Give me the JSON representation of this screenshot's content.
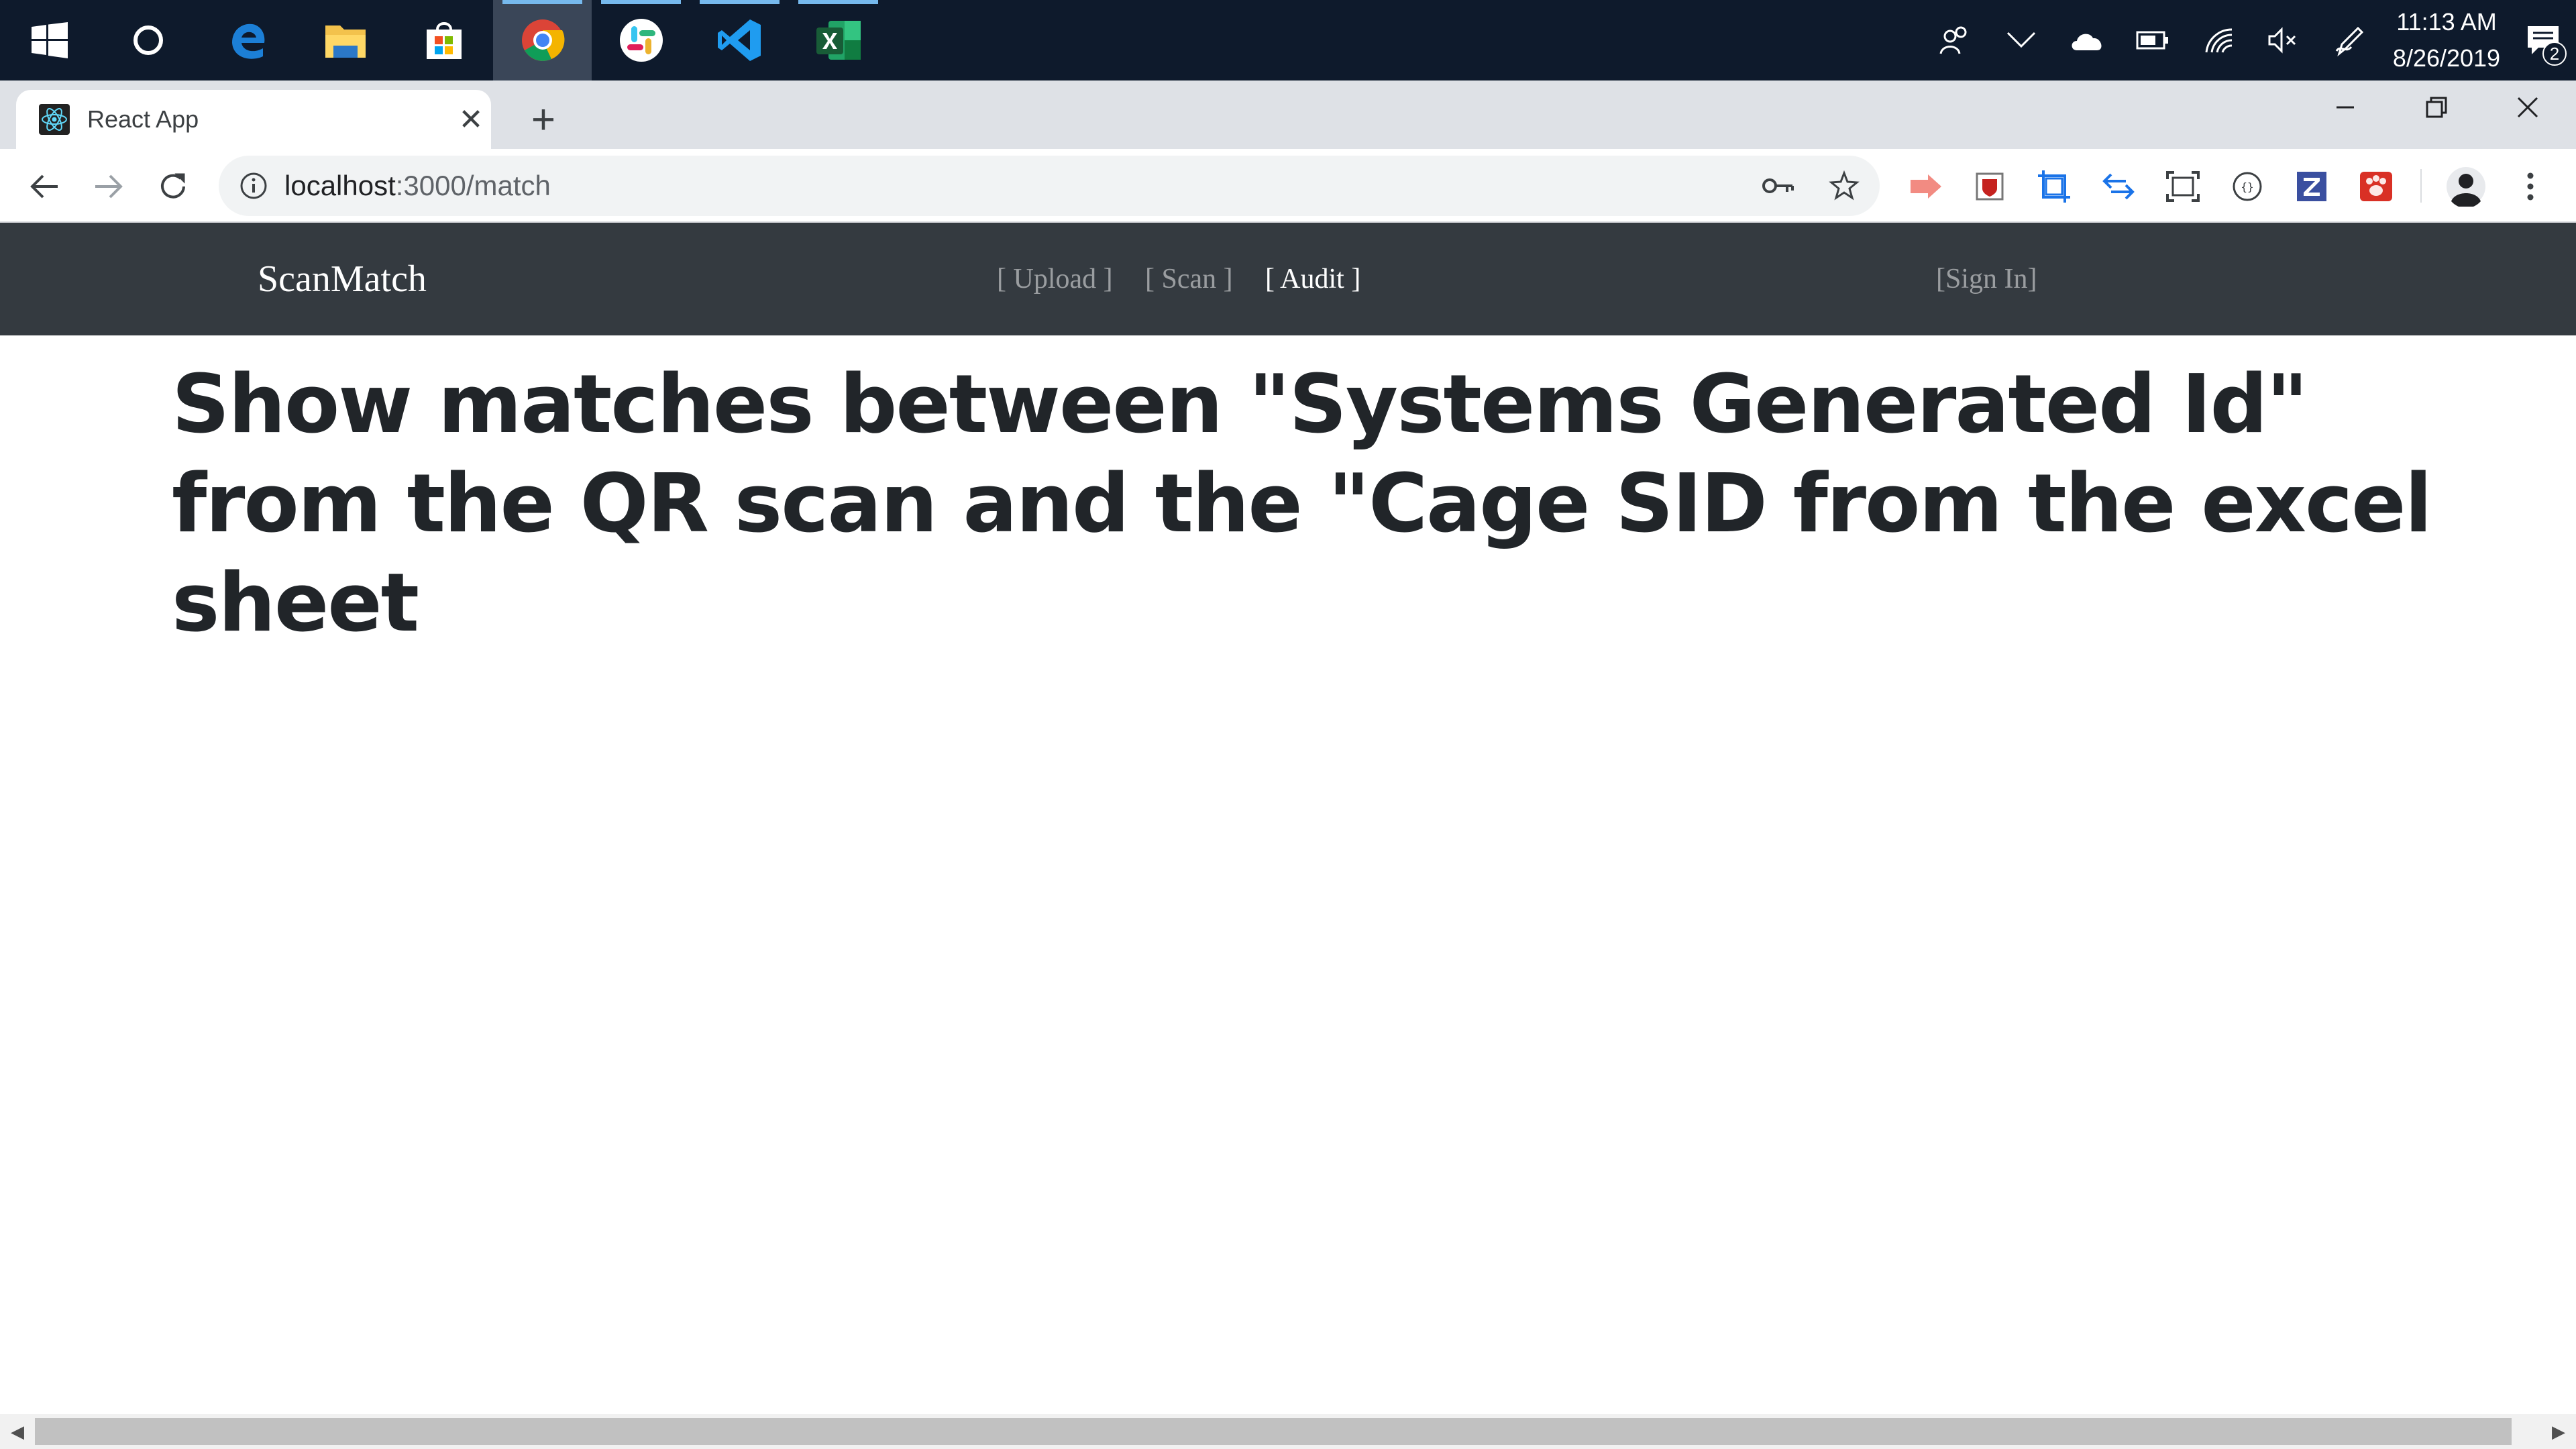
{
  "taskbar": {
    "apps": [
      {
        "name": "windows-start-icon"
      },
      {
        "name": "cortana-icon"
      },
      {
        "name": "edge-icon"
      },
      {
        "name": "file-explorer-icon"
      },
      {
        "name": "store-icon"
      },
      {
        "name": "chrome-icon"
      },
      {
        "name": "slack-icon"
      },
      {
        "name": "vscode-icon"
      },
      {
        "name": "excel-icon"
      }
    ],
    "clock_time": "11:13 AM",
    "clock_date": "8/26/2019",
    "notification_count": "2"
  },
  "browser": {
    "tab_title": "React App",
    "new_tab_label": "+",
    "url_host": "localhost",
    "url_path": ":3000/match"
  },
  "app": {
    "brand": "ScanMatch",
    "nav": {
      "upload": "[ Upload ]",
      "scan": "[ Scan ]",
      "audit": "[ Audit ]",
      "signin": "[Sign In]"
    },
    "heading": "Show matches between \"Systems Generated Id\" from the QR scan and the \"Cage SID from the excel sheet"
  },
  "colors": {
    "navbar_bg": "#343a40",
    "taskbar_bg": "#0e1a2c",
    "heading_text": "#212529"
  }
}
